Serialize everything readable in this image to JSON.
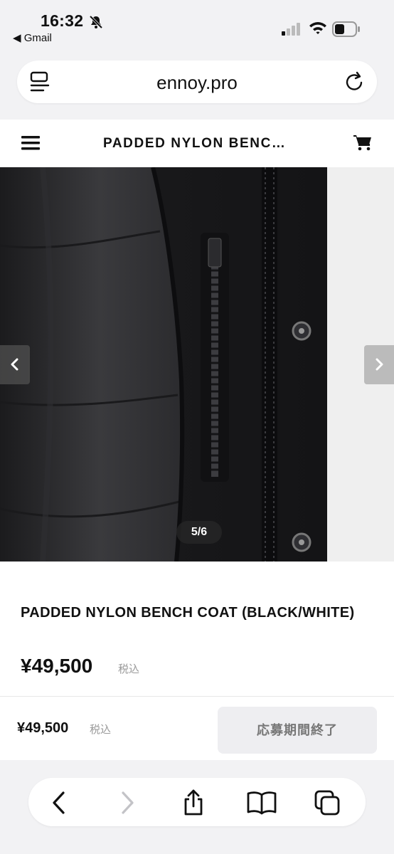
{
  "status": {
    "time": "16:32",
    "back_app": "◀ Gmail"
  },
  "browser": {
    "url": "ennoy.pro"
  },
  "header": {
    "title": "PADDED NYLON BENC…"
  },
  "gallery": {
    "counter": "5/6",
    "current": 5,
    "total": 6
  },
  "product": {
    "name": "PADDED NYLON BENCH COAT (BLACK/WHITE)",
    "price": "¥49,500",
    "tax_label": "税込"
  },
  "buy_bar": {
    "price": "¥49,500",
    "tax_label": "税込",
    "button_label": "応募期間終了"
  },
  "icons": {
    "bell": "bell-slash-icon",
    "signal": "signal-icon",
    "wifi": "wifi-icon",
    "battery": "battery-icon",
    "reader": "reader-icon",
    "reload": "reload-icon",
    "menu": "hamburger-menu-icon",
    "cart": "cart-icon",
    "prev": "chevron-left-icon",
    "next": "chevron-right-icon",
    "back": "back-icon",
    "forward": "forward-icon",
    "share": "share-icon",
    "bookmarks": "book-icon",
    "tabs": "tabs-icon"
  },
  "colors": {
    "chrome_bg": "#f2f2f4",
    "text": "#111111",
    "muted": "#999999",
    "button_bg": "#eeeef1"
  }
}
